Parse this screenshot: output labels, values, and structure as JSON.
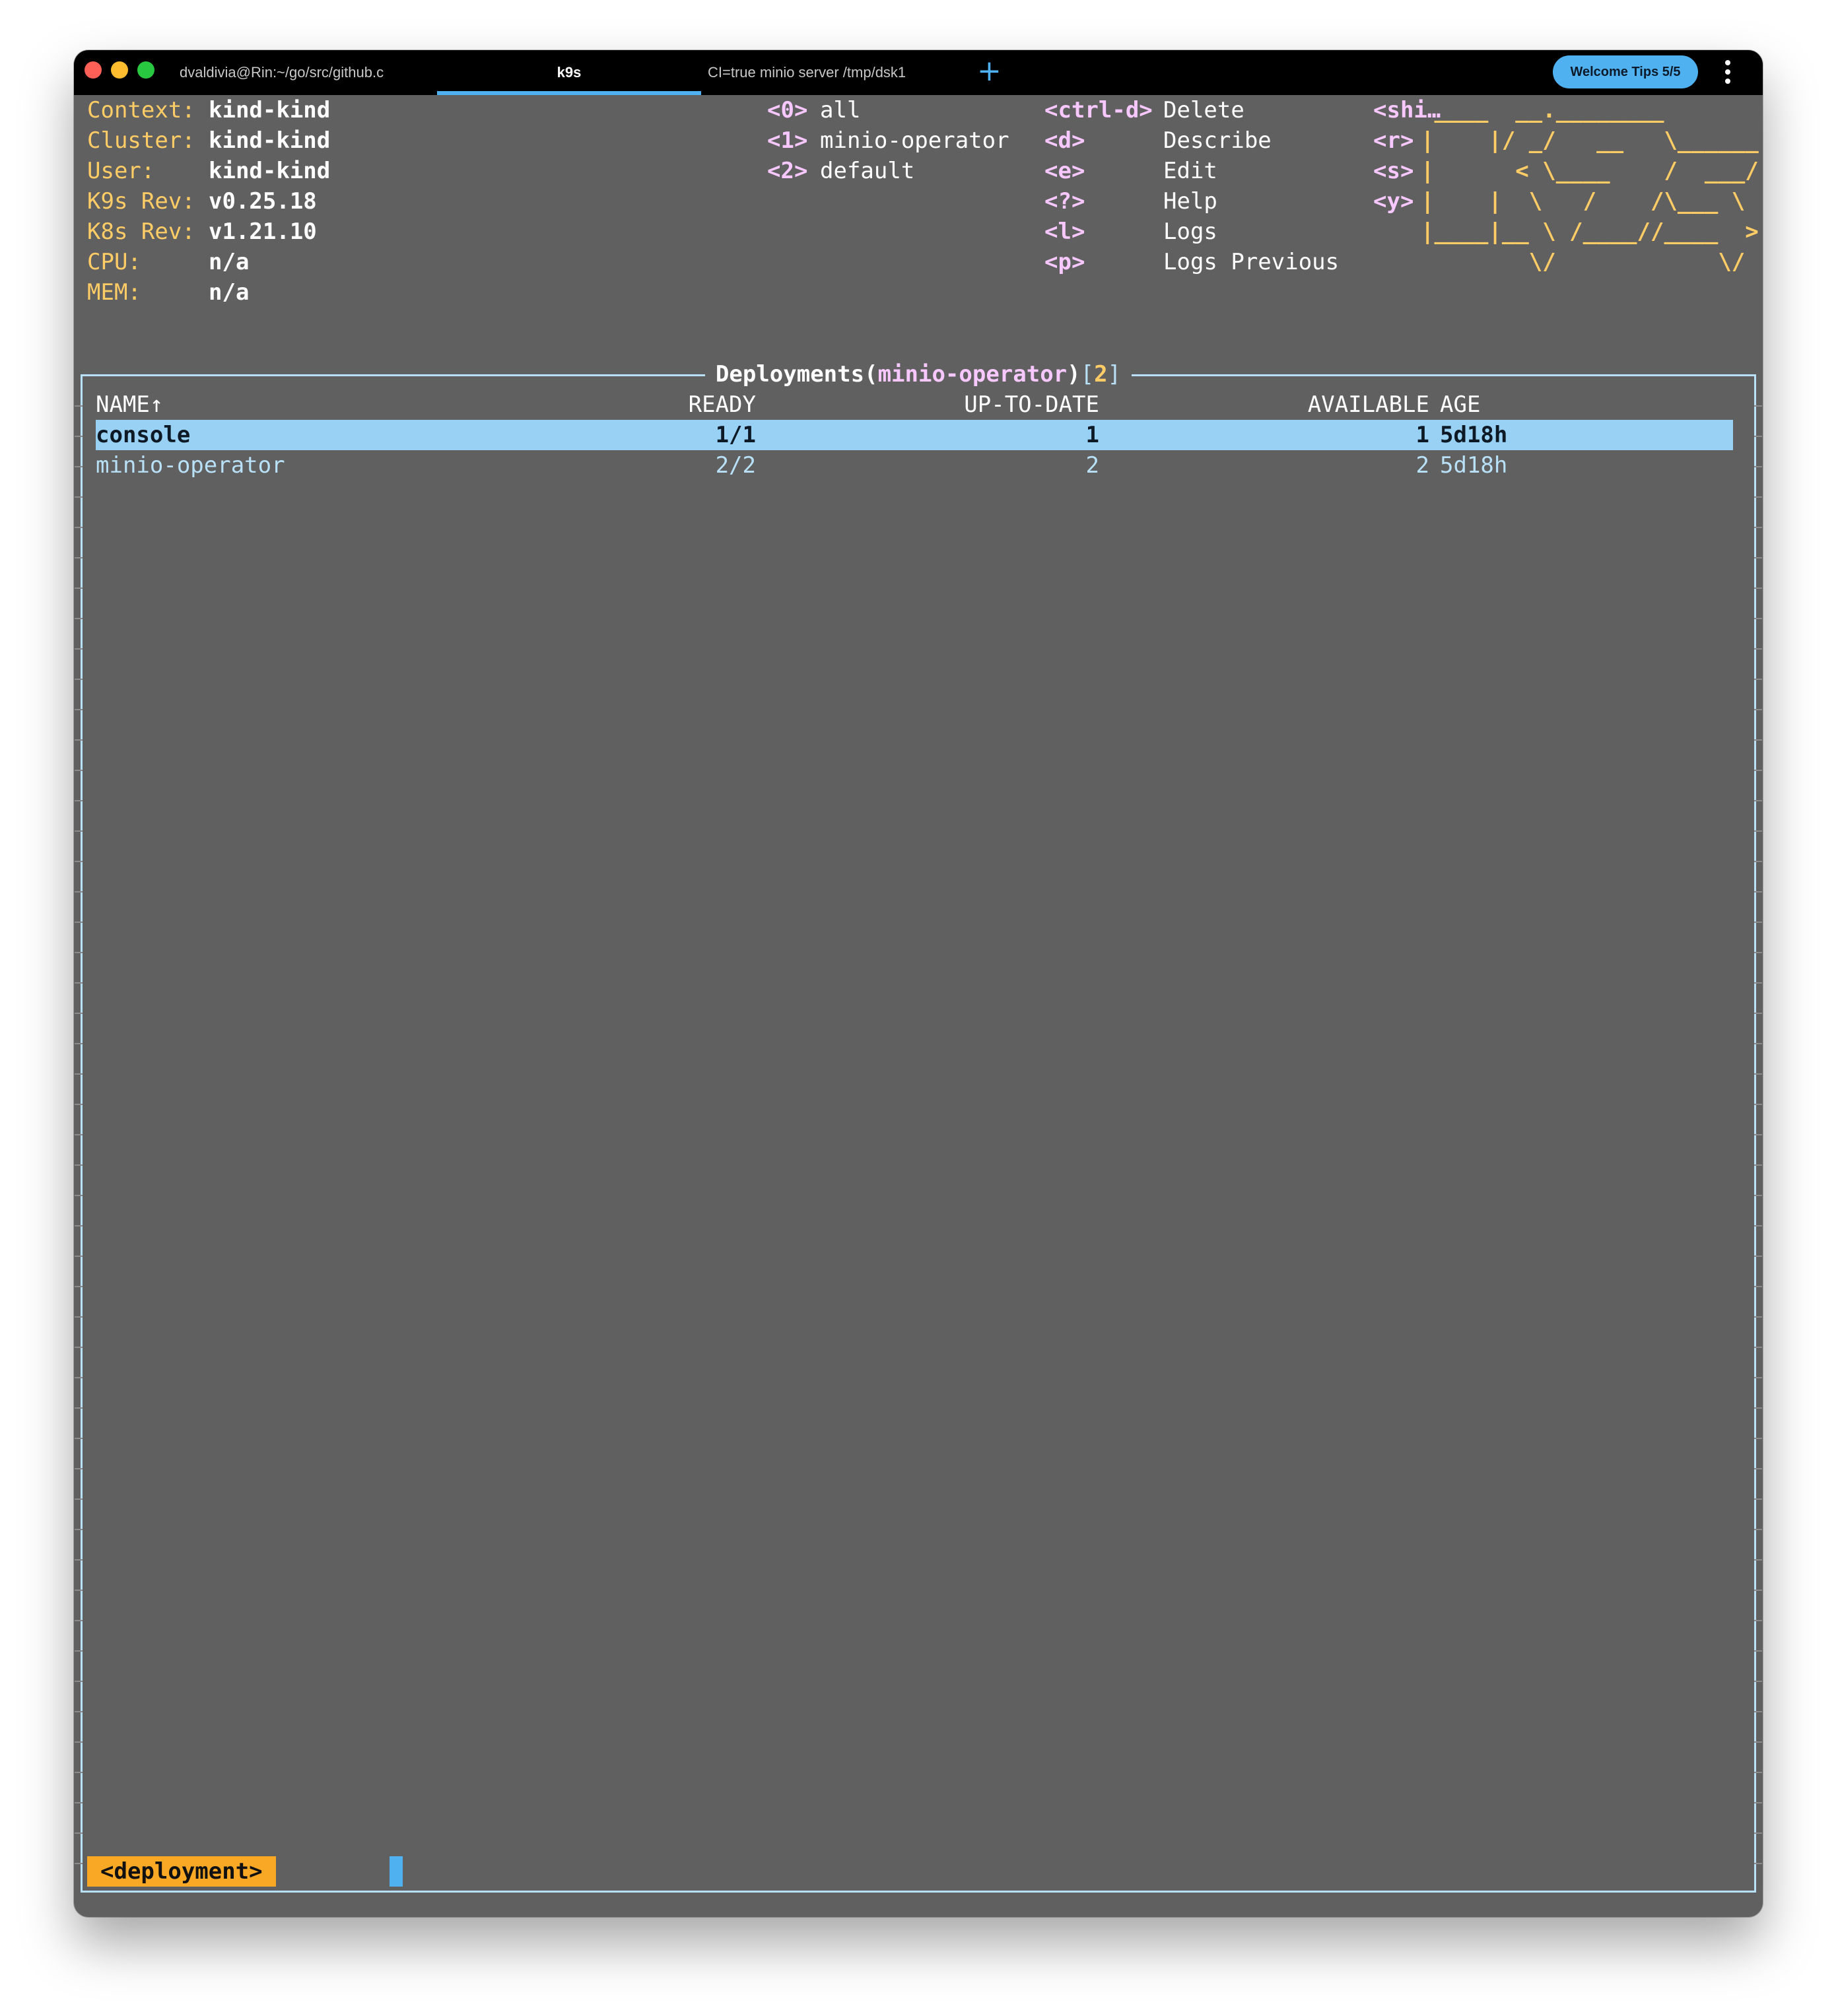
{
  "titlebar": {
    "tabs": [
      {
        "label": "dvaldivia@Rin:~/go/src/github.c"
      },
      {
        "label": "k9s"
      },
      {
        "label": "CI=true minio server /tmp/dsk1"
      }
    ],
    "new_tab_glyph": "+",
    "welcome_label": "Welcome Tips 5/5"
  },
  "info": [
    {
      "label": "Context:",
      "value": "kind-kind"
    },
    {
      "label": "Cluster:",
      "value": "kind-kind"
    },
    {
      "label": "User:",
      "value": "kind-kind"
    },
    {
      "label": "K9s Rev:",
      "value": "v0.25.18"
    },
    {
      "label": "K8s Rev:",
      "value": "v1.21.10"
    },
    {
      "label": "CPU:",
      "value": "n/a"
    },
    {
      "label": "MEM:",
      "value": "n/a"
    }
  ],
  "namespaces": [
    {
      "key": "<0>",
      "label": "all"
    },
    {
      "key": "<1>",
      "label": "minio-operator"
    },
    {
      "key": "<2>",
      "label": "default"
    }
  ],
  "shortcuts": [
    {
      "key": "<ctrl-d>",
      "label": "Delete"
    },
    {
      "key": "<d>",
      "label": "Describe"
    },
    {
      "key": "<e>",
      "label": "Edit"
    },
    {
      "key": "<?>",
      "label": "Help"
    },
    {
      "key": "<l>",
      "label": "Logs"
    },
    {
      "key": "<p>",
      "label": "Logs Previous"
    }
  ],
  "shortcuts2": [
    {
      "key": "<shi…"
    },
    {
      "key": "<r>"
    },
    {
      "key": "<s>"
    },
    {
      "key": "<y>"
    }
  ],
  "logo_lines": [
    " ____  __.________",
    "|    |/ _/   __   \\______",
    "|      < \\____    /  ___/",
    "|    |  \\   /    /\\___ \\",
    "|____|__ \\ /____//____  >",
    "        \\/            \\/"
  ],
  "table": {
    "resource": "Deployments",
    "namespace": "minio-operator",
    "count": "2",
    "open_paren": "(",
    "close_paren": ")",
    "open_bracket": "[",
    "close_bracket": "]",
    "headers": {
      "name": "NAME↑",
      "ready": "READY",
      "up_to_date": "UP-TO-DATE",
      "available": "AVAILABLE",
      "age": "AGE"
    },
    "rows": [
      {
        "name": "console",
        "ready": "1/1",
        "up_to_date": "1",
        "available": "1",
        "age": "5d18h",
        "selected": true
      },
      {
        "name": "minio-operator",
        "ready": "2/2",
        "up_to_date": "2",
        "available": "2",
        "age": "5d18h",
        "selected": false
      }
    ]
  },
  "crumb": "<deployment>",
  "colors": {
    "accent": "#4fb1f0",
    "label": "#ffcc66",
    "key": "#f7c7ff",
    "crumb": "#f9a825",
    "selection": "#99d1f5",
    "background": "#606060"
  }
}
